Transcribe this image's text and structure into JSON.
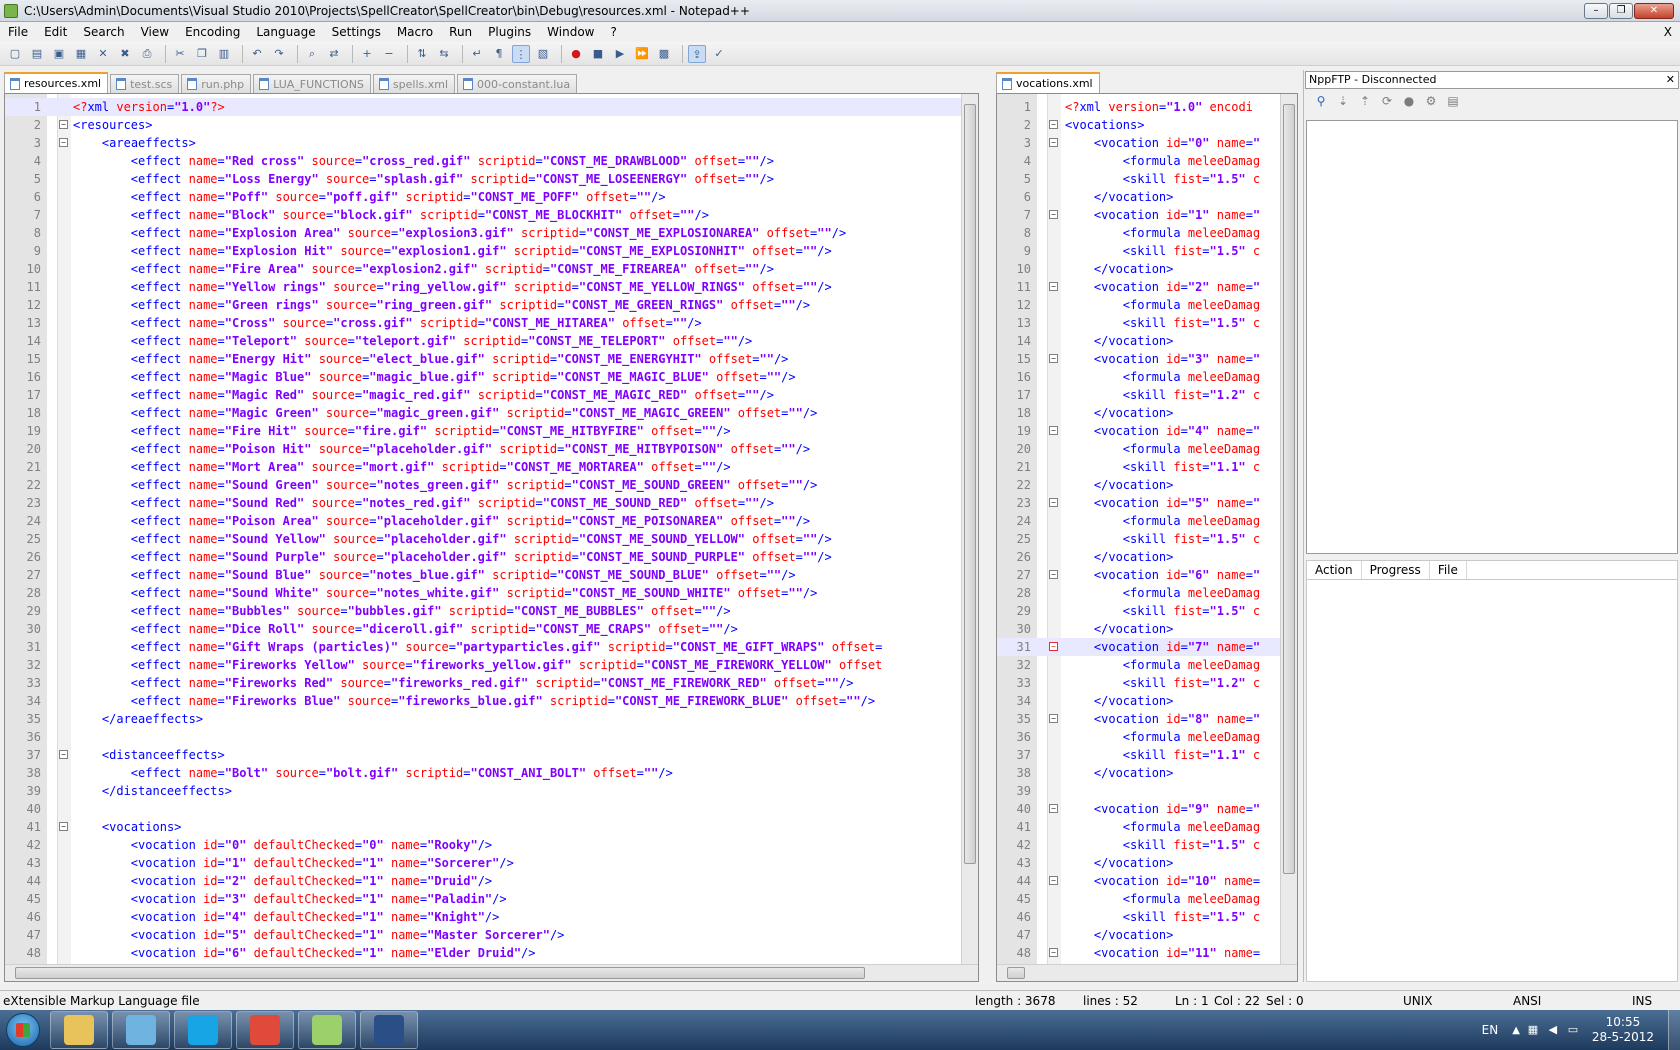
{
  "window": {
    "title": "C:\\Users\\Admin\\Documents\\Visual Studio 2010\\Projects\\SpellCreator\\SpellCreator\\bin\\Debug\\resources.xml - Notepad++",
    "min": "–",
    "max": "❐",
    "close": "✕"
  },
  "menu": [
    "File",
    "Edit",
    "Search",
    "View",
    "Encoding",
    "Language",
    "Settings",
    "Macro",
    "Run",
    "Plugins",
    "Window",
    "?"
  ],
  "menu_close": "X",
  "toolbar_icons": [
    "new-icon",
    "open-icon",
    "save-icon",
    "save-all-icon",
    "close-icon",
    "close-all-icon",
    "print-icon",
    "|",
    "cut-icon",
    "copy-icon",
    "paste-icon",
    "|",
    "undo-icon",
    "redo-icon",
    "|",
    "find-icon",
    "replace-icon",
    "|",
    "zoom-in-icon",
    "zoom-out-icon",
    "|",
    "sync-v-icon",
    "sync-h-icon",
    "|",
    "wrap-icon",
    "all-chars-icon",
    "indent-guide-icon",
    "lang-icon",
    "|",
    "record-macro-icon",
    "stop-macro-icon",
    "play-macro-icon",
    "run-macro-multiple-icon",
    "save-macro-icon",
    "|",
    "ftp-icon",
    "spell-check-icon"
  ],
  "left_tabs": [
    {
      "label": "resources.xml",
      "active": true
    },
    {
      "label": "test.scs",
      "active": false
    },
    {
      "label": "run.php",
      "active": false
    },
    {
      "label": "LUA_FUNCTIONS",
      "active": false
    },
    {
      "label": "spells.xml",
      "active": false
    },
    {
      "label": "000-constant.lua",
      "active": false
    }
  ],
  "right_tabs": [
    {
      "label": "vocations.xml",
      "active": true
    }
  ],
  "left_editor": {
    "lines": [
      "<?xml version=\"1.0\"?>",
      "<resources>",
      "    <areaeffects>",
      "        <effect name=\"Red cross\" source=\"cross_red.gif\" scriptid=\"CONST_ME_DRAWBLOOD\" offset=\"\"/>",
      "        <effect name=\"Loss Energy\" source=\"splash.gif\" scriptid=\"CONST_ME_LOSEENERGY\" offset=\"\"/>",
      "        <effect name=\"Poff\" source=\"poff.gif\" scriptid=\"CONST_ME_POFF\" offset=\"\"/>",
      "        <effect name=\"Block\" source=\"block.gif\" scriptid=\"CONST_ME_BLOCKHIT\" offset=\"\"/>",
      "        <effect name=\"Explosion Area\" source=\"explosion3.gif\" scriptid=\"CONST_ME_EXPLOSIONAREA\" offset=\"\"/>",
      "        <effect name=\"Explosion Hit\" source=\"explosion1.gif\" scriptid=\"CONST_ME_EXPLOSIONHIT\" offset=\"\"/>",
      "        <effect name=\"Fire Area\" source=\"explosion2.gif\" scriptid=\"CONST_ME_FIREAREA\" offset=\"\"/>",
      "        <effect name=\"Yellow rings\" source=\"ring_yellow.gif\" scriptid=\"CONST_ME_YELLOW_RINGS\" offset=\"\"/>",
      "        <effect name=\"Green rings\" source=\"ring_green.gif\" scriptid=\"CONST_ME_GREEN_RINGS\" offset=\"\"/>",
      "        <effect name=\"Cross\" source=\"cross.gif\" scriptid=\"CONST_ME_HITAREA\" offset=\"\"/>",
      "        <effect name=\"Teleport\" source=\"teleport.gif\" scriptid=\"CONST_ME_TELEPORT\" offset=\"\"/>",
      "        <effect name=\"Energy Hit\" source=\"elect_blue.gif\" scriptid=\"CONST_ME_ENERGYHIT\" offset=\"\"/>",
      "        <effect name=\"Magic Blue\" source=\"magic_blue.gif\" scriptid=\"CONST_ME_MAGIC_BLUE\" offset=\"\"/>",
      "        <effect name=\"Magic Red\" source=\"magic_red.gif\" scriptid=\"CONST_ME_MAGIC_RED\" offset=\"\"/>",
      "        <effect name=\"Magic Green\" source=\"magic_green.gif\" scriptid=\"CONST_ME_MAGIC_GREEN\" offset=\"\"/>",
      "        <effect name=\"Fire Hit\" source=\"fire.gif\" scriptid=\"CONST_ME_HITBYFIRE\" offset=\"\"/>",
      "        <effect name=\"Poison Hit\" source=\"placeholder.gif\" scriptid=\"CONST_ME_HITBYPOISON\" offset=\"\"/>",
      "        <effect name=\"Mort Area\" source=\"mort.gif\" scriptid=\"CONST_ME_MORTAREA\" offset=\"\"/>",
      "        <effect name=\"Sound Green\" source=\"notes_green.gif\" scriptid=\"CONST_ME_SOUND_GREEN\" offset=\"\"/>",
      "        <effect name=\"Sound Red\" source=\"notes_red.gif\" scriptid=\"CONST_ME_SOUND_RED\" offset=\"\"/>",
      "        <effect name=\"Poison Area\" source=\"placeholder.gif\" scriptid=\"CONST_ME_POISONAREA\" offset=\"\"/>",
      "        <effect name=\"Sound Yellow\" source=\"placeholder.gif\" scriptid=\"CONST_ME_SOUND_YELLOW\" offset=\"\"/>",
      "        <effect name=\"Sound Purple\" source=\"placeholder.gif\" scriptid=\"CONST_ME_SOUND_PURPLE\" offset=\"\"/>",
      "        <effect name=\"Sound Blue\" source=\"notes_blue.gif\" scriptid=\"CONST_ME_SOUND_BLUE\" offset=\"\"/>",
      "        <effect name=\"Sound White\" source=\"notes_white.gif\" scriptid=\"CONST_ME_SOUND_WHITE\" offset=\"\"/>",
      "        <effect name=\"Bubbles\" source=\"bubbles.gif\" scriptid=\"CONST_ME_BUBBLES\" offset=\"\"/>",
      "        <effect name=\"Dice Roll\" source=\"diceroll.gif\" scriptid=\"CONST_ME_CRAPS\" offset=\"\"/>",
      "        <effect name=\"Gift Wraps (particles)\" source=\"partyparticles.gif\" scriptid=\"CONST_ME_GIFT_WRAPS\" offset=",
      "        <effect name=\"Fireworks Yellow\" source=\"fireworks_yellow.gif\" scriptid=\"CONST_ME_FIREWORK_YELLOW\" offset",
      "        <effect name=\"Fireworks Red\" source=\"fireworks_red.gif\" scriptid=\"CONST_ME_FIREWORK_RED\" offset=\"\"/>",
      "        <effect name=\"Fireworks Blue\" source=\"fireworks_blue.gif\" scriptid=\"CONST_ME_FIREWORK_BLUE\" offset=\"\"/>",
      "    </areaeffects>",
      "",
      "    <distanceeffects>",
      "        <effect name=\"Bolt\" source=\"bolt.gif\" scriptid=\"CONST_ANI_BOLT\" offset=\"\"/>",
      "    </distanceeffects>",
      "",
      "    <vocations>",
      "        <vocation id=\"0\" defaultChecked=\"0\" name=\"Rooky\"/>",
      "        <vocation id=\"1\" defaultChecked=\"1\" name=\"Sorcerer\"/>",
      "        <vocation id=\"2\" defaultChecked=\"1\" name=\"Druid\"/>",
      "        <vocation id=\"3\" defaultChecked=\"1\" name=\"Paladin\"/>",
      "        <vocation id=\"4\" defaultChecked=\"1\" name=\"Knight\"/>",
      "        <vocation id=\"5\" defaultChecked=\"1\" name=\"Master Sorcerer\"/>",
      "        <vocation id=\"6\" defaultChecked=\"1\" name=\"Elder Druid\"/>"
    ],
    "folds_open": [
      2,
      3,
      37,
      41
    ],
    "fold_ends": [
      35,
      39
    ],
    "current_line": 1
  },
  "right_editor": {
    "lines": [
      "<?xml version=\"1.0\" encodi",
      "<vocations>",
      "    <vocation id=\"0\" name=\"",
      "        <formula meleeDamag",
      "        <skill fist=\"1.5\" c",
      "    </vocation>",
      "    <vocation id=\"1\" name=\"",
      "        <formula meleeDamag",
      "        <skill fist=\"1.5\" c",
      "    </vocation>",
      "    <vocation id=\"2\" name=\"",
      "        <formula meleeDamag",
      "        <skill fist=\"1.5\" c",
      "    </vocation>",
      "    <vocation id=\"3\" name=\"",
      "        <formula meleeDamag",
      "        <skill fist=\"1.2\" c",
      "    </vocation>",
      "    <vocation id=\"4\" name=\"",
      "        <formula meleeDamag",
      "        <skill fist=\"1.1\" c",
      "    </vocation>",
      "    <vocation id=\"5\" name=\"",
      "        <formula meleeDamag",
      "        <skill fist=\"1.5\" c",
      "    </vocation>",
      "    <vocation id=\"6\" name=\"",
      "        <formula meleeDamag",
      "        <skill fist=\"1.5\" c",
      "    </vocation>",
      "    <vocation id=\"7\" name=\"",
      "        <formula meleeDamag",
      "        <skill fist=\"1.2\" c",
      "    </vocation>",
      "    <vocation id=\"8\" name=\"",
      "        <formula meleeDamag",
      "        <skill fist=\"1.1\" c",
      "    </vocation>",
      "",
      "    <vocation id=\"9\" name=\"",
      "        <formula meleeDamag",
      "        <skill fist=\"1.5\" c",
      "    </vocation>",
      "    <vocation id=\"10\" name=",
      "        <formula meleeDamag",
      "        <skill fist=\"1.5\" c",
      "    </vocation>",
      "    <vocation id=\"11\" name="
    ],
    "folds_open": [
      2,
      3,
      7,
      11,
      15,
      19,
      23,
      27,
      31,
      35,
      40,
      44,
      48
    ],
    "fold_red": [
      31
    ],
    "fold_ends": [
      6,
      10,
      14,
      18,
      22,
      26,
      30,
      34,
      38,
      43,
      47
    ],
    "current_line": 31
  },
  "nppftp": {
    "title": "NppFTP - Disconnected",
    "close": "✕",
    "tools": [
      "connect-icon",
      "download-icon",
      "upload-icon",
      "refresh-icon",
      "abort-icon",
      "settings-icon",
      "messages-icon"
    ],
    "columns": [
      "Action",
      "Progress",
      "File"
    ]
  },
  "status": {
    "filetype": "eXtensible Markup Language file",
    "length": "length : 3678",
    "lines": "lines : 52",
    "ln": "Ln : 1",
    "col": "Col : 22",
    "sel": "Sel : 0",
    "eol": "UNIX",
    "encoding": "ANSI",
    "mode": "INS"
  },
  "taskbar": {
    "apps": [
      {
        "name": "explorer-icon",
        "color": "#e8c25a"
      },
      {
        "name": "users-icon",
        "color": "#6fb3e0"
      },
      {
        "name": "skype-icon",
        "color": "#17a5e6"
      },
      {
        "name": "chrome-icon",
        "color": "#e04a3a"
      },
      {
        "name": "notepadpp-icon",
        "color": "#9bd06a"
      },
      {
        "name": "lol-icon",
        "color": "#2a4f86"
      }
    ],
    "lang": "EN",
    "time": "10:55",
    "date": "28-5-2012"
  }
}
